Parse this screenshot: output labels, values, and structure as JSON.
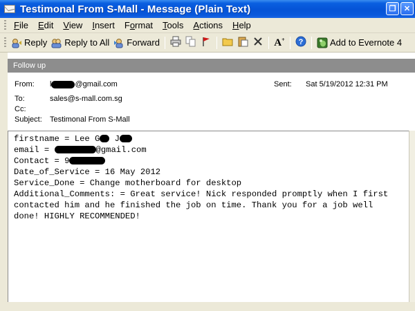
{
  "window": {
    "title": "Testimonal From S-Mall - Message (Plain Text)"
  },
  "menu": [
    {
      "label": "File",
      "accel": "F",
      "rest": "ile"
    },
    {
      "label": "Edit",
      "accel": "E",
      "rest": "dit"
    },
    {
      "label": "View",
      "accel": "V",
      "rest": "iew"
    },
    {
      "label": "Insert",
      "accel": "I",
      "rest": "nsert"
    },
    {
      "label": "Format",
      "accel": "o",
      "pre": "F",
      "rest": "rmat"
    },
    {
      "label": "Tools",
      "accel": "T",
      "rest": "ools"
    },
    {
      "label": "Actions",
      "accel": "A",
      "rest": "ctions"
    },
    {
      "label": "Help",
      "accel": "H",
      "rest": "elp"
    }
  ],
  "toolbar": {
    "reply": "Reply",
    "reply_all": "Reply to All",
    "forward": "Forward",
    "evernote": "Add to Evernote 4"
  },
  "infobar": {
    "text": "Follow up"
  },
  "header": {
    "from_label": "From:",
    "from_value_prefix": "l",
    "from_value_suffix": "@gmail.com",
    "to_label": "To:",
    "to_value": "sales@s-mall.com.sg",
    "cc_label": "Cc:",
    "cc_value": "",
    "subject_label": "Subject:",
    "subject_value": "Testimonal From S-Mall",
    "sent_label": "Sent:",
    "sent_value": "Sat 5/19/2012 12:31 PM"
  },
  "body": {
    "line1_prefix": "firstname = Lee G",
    "line1_mid": " J",
    "line2_prefix": "email = ",
    "line2_suffix": "@gmail.com",
    "line3_prefix": "Contact = 9",
    "line4": "Date_of_Service = 16 May 2012",
    "line5": "Service_Done = Change motherboard for desktop",
    "line6": "Additional_Comments: = Great service! Nick responded promptly when I first contacted him and he finished the job on time. Thank you for a job well done! HIGHLY RECOMMENDED!"
  }
}
